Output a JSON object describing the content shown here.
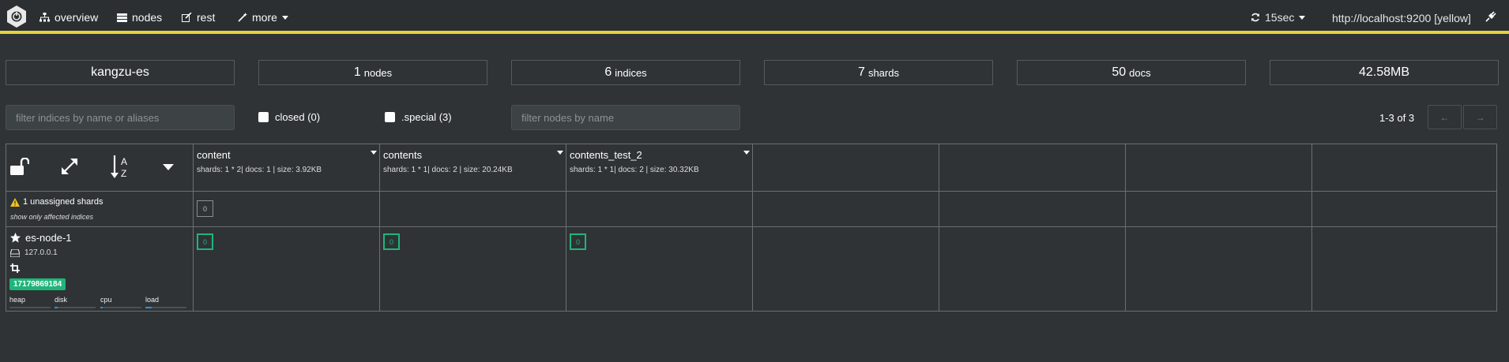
{
  "navbar": {
    "items": [
      {
        "label": "overview",
        "icon": "sitemap-icon"
      },
      {
        "label": "nodes",
        "icon": "server-icon"
      },
      {
        "label": "rest",
        "icon": "edit-icon"
      },
      {
        "label": "more",
        "icon": "wand-icon"
      }
    ],
    "refresh_label": "15sec",
    "cluster_url": "http://localhost:9200 [yellow]",
    "accent_color": "#e5d33b"
  },
  "stats": {
    "cluster_name": "kangzu-es",
    "nodes_count": "1",
    "nodes_unit": "nodes",
    "indices_count": "6",
    "indices_unit": "indices",
    "shards_count": "7",
    "shards_unit": "shards",
    "docs_count": "50",
    "docs_unit": "docs",
    "size": "42.58MB"
  },
  "filters": {
    "indices_placeholder": "filter indices by name or aliases",
    "closed_label": "closed (0)",
    "special_label": ".special (3)",
    "nodes_placeholder": "filter nodes by name",
    "pagination": "1-3 of 3",
    "prev_label": "←",
    "next_label": "→"
  },
  "indices": [
    {
      "name": "content",
      "meta": "shards: 1 * 2| docs: 1 | size: 3.92KB",
      "unassigned_shard": "0",
      "node_shard": "0"
    },
    {
      "name": "contents",
      "meta": "shards: 1 * 1| docs: 2 | size: 20.24KB",
      "unassigned_shard": "",
      "node_shard": "0"
    },
    {
      "name": "contents_test_2",
      "meta": "shards: 1 * 1| docs: 2 | size: 30.32KB",
      "unassigned_shard": "",
      "node_shard": "0"
    }
  ],
  "unassigned": {
    "label": "1 unassigned shards",
    "sub_label": "show only affected indices"
  },
  "node": {
    "name": "es-node-1",
    "ip": "127.0.0.1",
    "badge": "17179869184",
    "badge_color": "#1fb57a",
    "metrics": [
      {
        "label": "heap",
        "level": 0.0
      },
      {
        "label": "disk",
        "level": 0.08
      },
      {
        "label": "cpu",
        "level": 0.05
      },
      {
        "label": "load",
        "level": 0.15
      }
    ]
  }
}
